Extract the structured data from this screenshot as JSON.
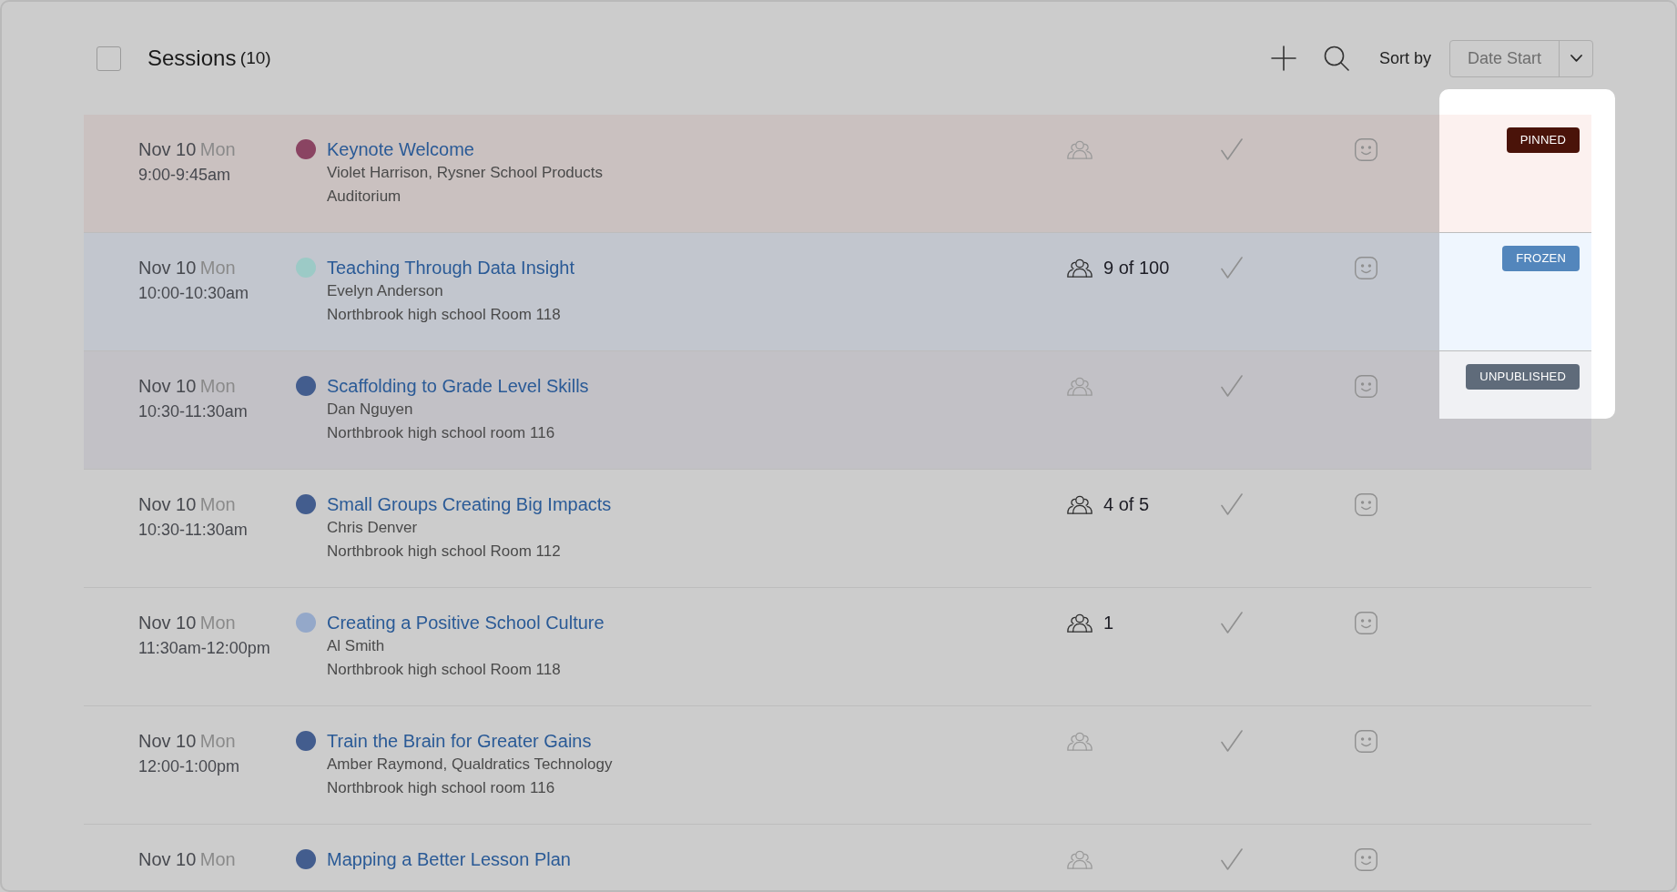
{
  "header": {
    "select_all": {
      "checked": false
    },
    "title": "Sessions",
    "count": "(10)",
    "sort": {
      "label": "Sort by",
      "value": "Date Start"
    }
  },
  "badges_highlighted": true,
  "sessions": [
    {
      "kind": "pinned",
      "date": "Nov 10",
      "weekday": "Mon",
      "time": "9:00-9:45am",
      "color": "#8a4462",
      "title": "Keynote Welcome",
      "presenter": "Violet Harrison, Rysner School Products",
      "location": "Auditorium",
      "badge": "PINNED"
    },
    {
      "kind": "frozen",
      "date": "Nov 10",
      "weekday": "Mon",
      "time": "10:00-10:30am",
      "color": "#9ccac6",
      "title": "Teaching Through Data Insight",
      "presenter": "Evelyn Anderson",
      "location": "Northbrook high school Room 118",
      "attendance": "9 of 100",
      "badge": "FROZEN"
    },
    {
      "kind": "unpublished",
      "date": "Nov 10",
      "weekday": "Mon",
      "time": "10:30-11:30am",
      "color": "#435d8e",
      "title": "Scaffolding to Grade Level Skills",
      "presenter": "Dan Nguyen",
      "location": "Northbrook high school room 116",
      "badge": "UNPUBLISHED"
    },
    {
      "kind": "normal",
      "date": "Nov 10",
      "weekday": "Mon",
      "time": "10:30-11:30am",
      "color": "#435d8e",
      "title": "Small Groups Creating Big Impacts",
      "presenter": "Chris Denver",
      "location": "Northbrook high school Room 112",
      "attendance": "4 of 5"
    },
    {
      "kind": "normal",
      "date": "Nov 10",
      "weekday": "Mon",
      "time": "11:30am-12:00pm",
      "color": "#94a8c9",
      "title": "Creating a Positive School Culture",
      "presenter": "Al Smith",
      "location": "Northbrook high school Room 118",
      "attendance": "1"
    },
    {
      "kind": "normal",
      "date": "Nov 10",
      "weekday": "Mon",
      "time": "12:00-1:00pm",
      "color": "#435d8e",
      "title": "Train the Brain for Greater Gains",
      "presenter": "Amber Raymond, Qualdratics Technology",
      "location": "Northbrook high school room 116"
    },
    {
      "kind": "normal",
      "date": "Nov 10",
      "weekday": "Mon",
      "color": "#435d8e",
      "title": "Mapping a Better Lesson Plan"
    }
  ]
}
